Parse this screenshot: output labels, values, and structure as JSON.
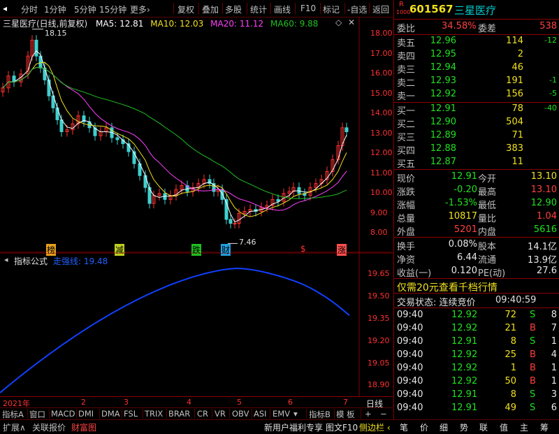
{
  "toolbar": {
    "items": [
      "分时",
      "1分钟",
      "5分钟",
      "15分钟",
      "更多›",
      "复权",
      "叠加",
      "多股",
      "统计",
      "画线",
      "F10",
      "标记",
      "-自选",
      "返回"
    ]
  },
  "main_chart": {
    "title": "三星医疗(日线,前复权)",
    "ma5": "MA5: 12.81",
    "ma10": "MA10: 12.03",
    "ma20": "MA20: 11.12",
    "ma60": "MA60: 9.88",
    "high_label": "18.15",
    "low_label": "7.46",
    "y_ticks": [
      "18.00",
      "17.00",
      "16.00",
      "15.00",
      "14.00",
      "13.00",
      "12.00",
      "11.00",
      "10.00",
      "9.00",
      "8.00"
    ],
    "markers": [
      "榜",
      "减",
      "跌",
      "财",
      "$",
      "涨"
    ],
    "colors": {
      "ma5": "#ffffff",
      "ma10": "#f0e020",
      "ma20": "#ff40ff",
      "ma60": "#20c020",
      "up": "#ff3030",
      "down": "#40d0d0",
      "axis": "#8b0000"
    }
  },
  "sub_chart": {
    "title": "指标公式",
    "line_label": "走强线: 19.48",
    "y_ticks": [
      "19.65",
      "19.50",
      "19.35",
      "19.20",
      "19.05",
      "18.90"
    ]
  },
  "x_axis": {
    "labels": [
      "2021年",
      "2",
      "3",
      "4",
      "5",
      "6",
      "7"
    ],
    "period": "日线"
  },
  "indicator_bar": {
    "items": [
      "指标A",
      "窗口",
      "MACD",
      "DMI",
      "DMA",
      "FSL",
      "TRIX",
      "BRAR",
      "CR",
      "VR",
      "OBV",
      "ASI",
      "EMV",
      "▾",
      "指标B",
      "模 板",
      "+",
      "−"
    ]
  },
  "status_bar": {
    "left": [
      "扩展∧",
      "关联报价",
      "财富图"
    ],
    "right": [
      "新用户福利专享",
      "图文F10",
      "侧边栏 ‹"
    ],
    "tabs": [
      "笔",
      "价",
      "细",
      "势",
      "联",
      "值",
      "主",
      "筹"
    ]
  },
  "quote": {
    "badge_top": "R",
    "badge_bottom": "1000",
    "code": "601567",
    "name": "三星医疗",
    "weibi_label": "委比",
    "weibi": "34.58%",
    "weicha_label": "委差",
    "weicha": "538",
    "asks": [
      {
        "label": "卖五",
        "price": "12.96",
        "vol": "114",
        "chg": "-12"
      },
      {
        "label": "卖四",
        "price": "12.95",
        "vol": "2",
        "chg": ""
      },
      {
        "label": "卖三",
        "price": "12.94",
        "vol": "46",
        "chg": ""
      },
      {
        "label": "卖二",
        "price": "12.93",
        "vol": "191",
        "chg": "-1"
      },
      {
        "label": "卖一",
        "price": "12.92",
        "vol": "156",
        "chg": "-5"
      }
    ],
    "bids": [
      {
        "label": "买一",
        "price": "12.91",
        "vol": "78",
        "chg": "-40"
      },
      {
        "label": "买二",
        "price": "12.90",
        "vol": "504",
        "chg": ""
      },
      {
        "label": "买三",
        "price": "12.89",
        "vol": "71",
        "chg": ""
      },
      {
        "label": "买四",
        "price": "12.88",
        "vol": "383",
        "chg": ""
      },
      {
        "label": "买五",
        "price": "12.87",
        "vol": "11",
        "chg": ""
      }
    ],
    "stats1": [
      {
        "l1": "现价",
        "v1": "12.91",
        "l2": "今开",
        "v2": "13.10"
      },
      {
        "l1": "涨跌",
        "v1": "-0.20",
        "l2": "最高",
        "v2": "13.10"
      },
      {
        "l1": "涨幅",
        "v1": "-1.53%",
        "l2": "最低",
        "v2": "12.90"
      },
      {
        "l1": "总量",
        "v1": "10817",
        "l2": "量比",
        "v2": "1.04"
      },
      {
        "l1": "外盘",
        "v1": "5201",
        "l2": "内盘",
        "v2": "5616"
      }
    ],
    "stats2": [
      {
        "l1": "换手",
        "v1": "0.08%",
        "l2": "股本",
        "v2": "14.1亿"
      },
      {
        "l1": "净资",
        "v1": "6.44",
        "l2": "流通",
        "v2": "13.9亿"
      },
      {
        "l1": "收益(一)",
        "v1": "0.120",
        "l2": "PE(动)",
        "v2": "27.6"
      }
    ],
    "promo": "仅需20元查看千档行情",
    "trade_status": "交易状态: 连续竞价",
    "trade_time": "09:40:59",
    "ticks": [
      {
        "time": "09:40",
        "price": "12.92",
        "vol": "72",
        "bs": "S",
        "n": "8"
      },
      {
        "time": "09:40",
        "price": "12.92",
        "vol": "21",
        "bs": "B",
        "n": "7"
      },
      {
        "time": "09:40",
        "price": "12.91",
        "vol": "8",
        "bs": "S",
        "n": "1"
      },
      {
        "time": "09:40",
        "price": "12.92",
        "vol": "25",
        "bs": "B",
        "n": "4"
      },
      {
        "time": "09:40",
        "price": "12.92",
        "vol": "1",
        "bs": "B",
        "n": "1"
      },
      {
        "time": "09:40",
        "price": "12.92",
        "vol": "50",
        "bs": "B",
        "n": "1"
      },
      {
        "time": "09:40",
        "price": "12.91",
        "vol": "8",
        "bs": "S",
        "n": "3"
      },
      {
        "time": "09:40",
        "price": "12.91",
        "vol": "49",
        "bs": "S",
        "n": "6"
      }
    ]
  }
}
